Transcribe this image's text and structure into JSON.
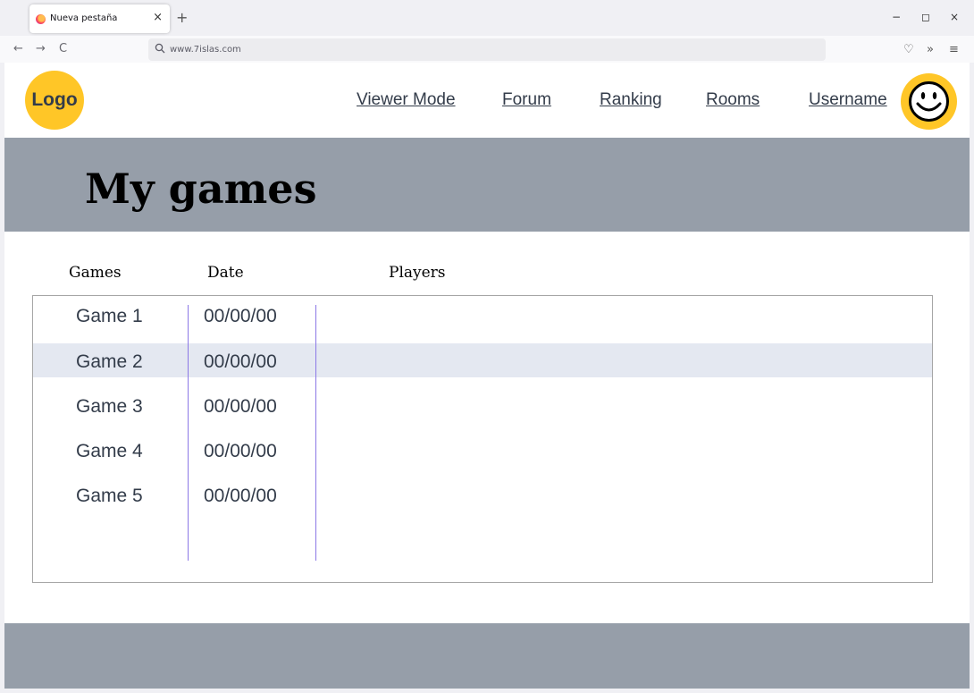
{
  "browser": {
    "tab_title": "Nueva pestaña",
    "tab_close": "×",
    "new_tab": "+",
    "url": "www.7islas.com",
    "back": "←",
    "forward": "→",
    "reload": "C",
    "pocket": "♡",
    "overflow": "»",
    "menu": "≡",
    "minimize": "−",
    "maximize": "◻",
    "close": "×"
  },
  "header": {
    "logo": "Logo",
    "nav": {
      "viewer_mode": "Viewer Mode",
      "forum": "Forum",
      "ranking": "Ranking",
      "rooms": "Rooms",
      "username": "Username"
    }
  },
  "hero": {
    "title": "My games"
  },
  "table": {
    "headers": {
      "games": "Games",
      "date": "Date",
      "players": "Players"
    },
    "rows": [
      {
        "game": "Game 1",
        "date": "00/00/00"
      },
      {
        "game": "Game 2",
        "date": "00/00/00"
      },
      {
        "game": "Game 3",
        "date": "00/00/00"
      },
      {
        "game": "Game 4",
        "date": "00/00/00"
      },
      {
        "game": "Game 5",
        "date": "00/00/00"
      }
    ]
  },
  "colors": {
    "accent_yellow": "#ffc627",
    "band_gray": "#969ea9",
    "row_highlight": "#e4e8f1",
    "divider_purple": "#8b78e6"
  }
}
